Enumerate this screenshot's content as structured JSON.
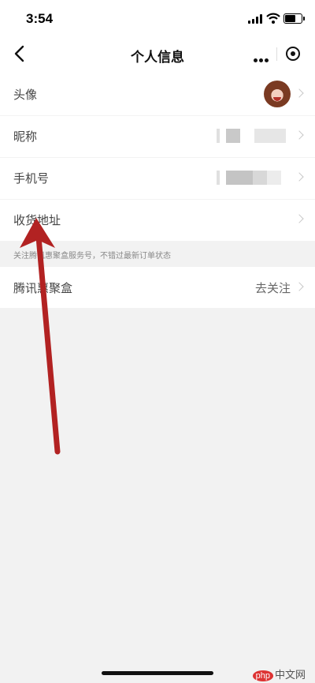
{
  "status_bar": {
    "time": "3:54"
  },
  "nav": {
    "title": "个人信息"
  },
  "rows": [
    {
      "label": "头像"
    },
    {
      "label": "昵称"
    },
    {
      "label": "手机号"
    },
    {
      "label": "收货地址"
    }
  ],
  "hint": "关注腾讯惠聚盒服务号，不错过最新订单状态",
  "follow": {
    "label": "腾讯惠聚盒",
    "action": "去关注"
  },
  "watermark": {
    "brand": "php",
    "text": "中文网"
  },
  "colors": {
    "arrow": "#b22222",
    "background": "#f2f2f2"
  },
  "icons": [
    "back-icon",
    "more-dots-icon",
    "target-icon",
    "chevron-right-icon",
    "signal-icon",
    "wifi-icon",
    "battery-icon"
  ]
}
